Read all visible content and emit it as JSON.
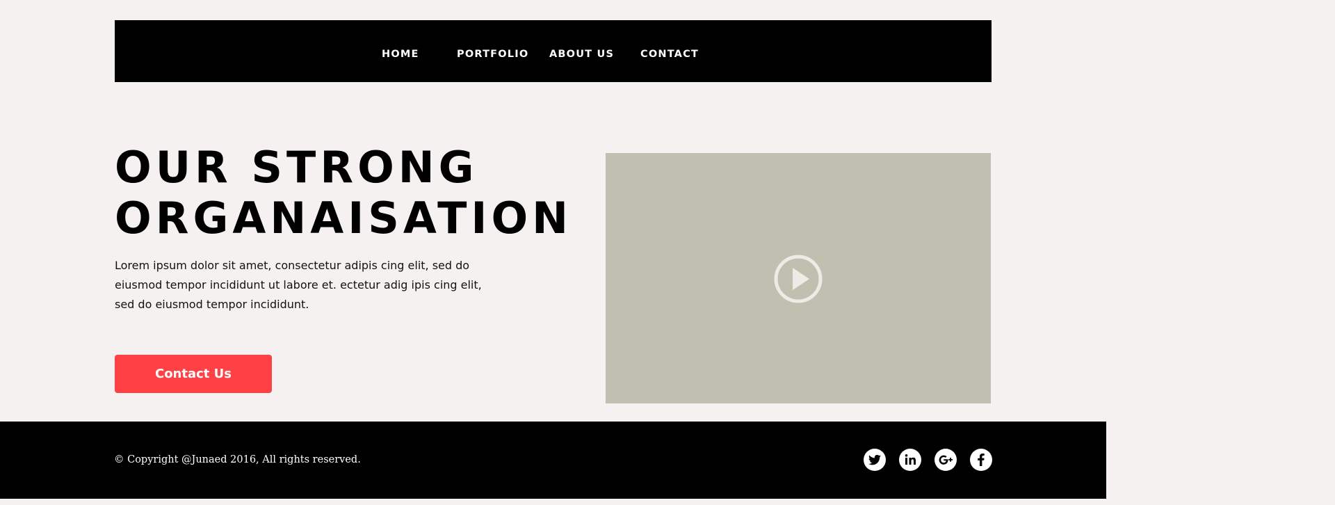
{
  "nav": {
    "items": [
      {
        "label": "HOME"
      },
      {
        "label": "PORTFOLIO"
      },
      {
        "label": "ABOUT US"
      },
      {
        "label": "CONTACT"
      }
    ]
  },
  "hero": {
    "title_line1": "OUR STRONG",
    "title_line2": "ORGANAISATION",
    "body": "Lorem ipsum dolor sit amet, consectetur adipis cing elit, sed do eiusmod tempor incididunt ut labore et. ectetur adig ipis cing elit, sed do eiusmod tempor incididunt.",
    "cta_label": "Contact Us",
    "cta_color": "#ff4146"
  },
  "video": {
    "background_color": "#c1bfb0",
    "icon": "play-circle-icon"
  },
  "footer": {
    "copyright": "© Copyright @Junaed 2016, All rights reserved.",
    "social": [
      {
        "icon": "twitter-icon"
      },
      {
        "icon": "linkedin-icon"
      },
      {
        "icon": "google-plus-icon"
      },
      {
        "icon": "facebook-icon"
      }
    ]
  }
}
